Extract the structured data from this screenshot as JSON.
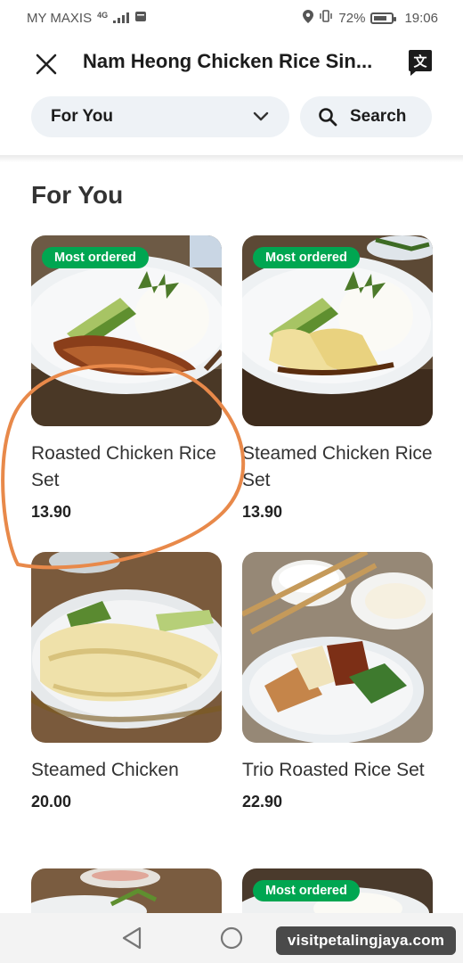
{
  "status_bar": {
    "carrier": "MY MAXIS",
    "network": "4G",
    "battery": "72%",
    "time": "19:06"
  },
  "header": {
    "title": "Nam Heong Chicken Rice Sin...",
    "close_icon": "close-icon",
    "translate_icon": "translate-icon"
  },
  "filters": {
    "category": "For You",
    "search_label": "Search"
  },
  "section": {
    "title": "For You"
  },
  "items": [
    {
      "name": "Roasted Chicken Rice Set",
      "price": "13.90",
      "badge": "Most ordered"
    },
    {
      "name": "Steamed Chicken Rice Set",
      "price": "13.90",
      "badge": "Most ordered"
    },
    {
      "name": "Steamed Chicken",
      "price": "20.00",
      "badge": ""
    },
    {
      "name": "Trio Roasted Rice Set",
      "price": "22.90",
      "badge": ""
    },
    {
      "name": "",
      "price": "",
      "badge": ""
    },
    {
      "name": "",
      "price": "",
      "badge": "Most ordered"
    }
  ],
  "nav": {
    "back_icon": "back-triangle-icon",
    "home_icon": "home-circle-icon",
    "recents_icon": "recents-square-icon"
  },
  "watermark": "visitpetalingjaya.com",
  "colors": {
    "badge_green": "#00a651",
    "pill_bg": "#eef2f6",
    "annotation_orange": "#e8894a"
  }
}
